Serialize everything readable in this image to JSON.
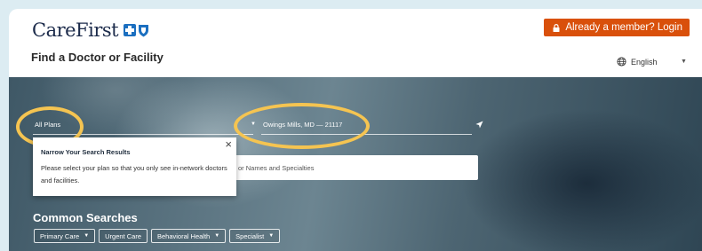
{
  "header": {
    "logo_text": "CareFirst",
    "login_label": "Already a member? Login",
    "page_title": "Find a Doctor or Facility",
    "language": "English"
  },
  "search": {
    "plan_value": "All Plans",
    "location_value": "Owings Mills, MD — 21117",
    "query_placeholder": "or Names and Specialties"
  },
  "tooltip": {
    "title": "Narrow Your Search Results",
    "body": "Please select your plan so that you only see in-network doctors and facilities.",
    "close": "×"
  },
  "common": {
    "title": "Common Searches",
    "chips": [
      {
        "label": "Primary Care",
        "dropdown": true
      },
      {
        "label": "Urgent Care",
        "dropdown": false
      },
      {
        "label": "Behavioral Health",
        "dropdown": true
      },
      {
        "label": "Specialist",
        "dropdown": true
      }
    ]
  },
  "icons": [
    "lock-icon",
    "globe-icon",
    "chevron-down-icon",
    "location-arrow-icon",
    "close-icon",
    "cross-logo-icon",
    "shield-logo-icon"
  ],
  "colors": {
    "accent": "#d9500b",
    "highlight": "#f5c451",
    "hero": "#4d6572"
  }
}
